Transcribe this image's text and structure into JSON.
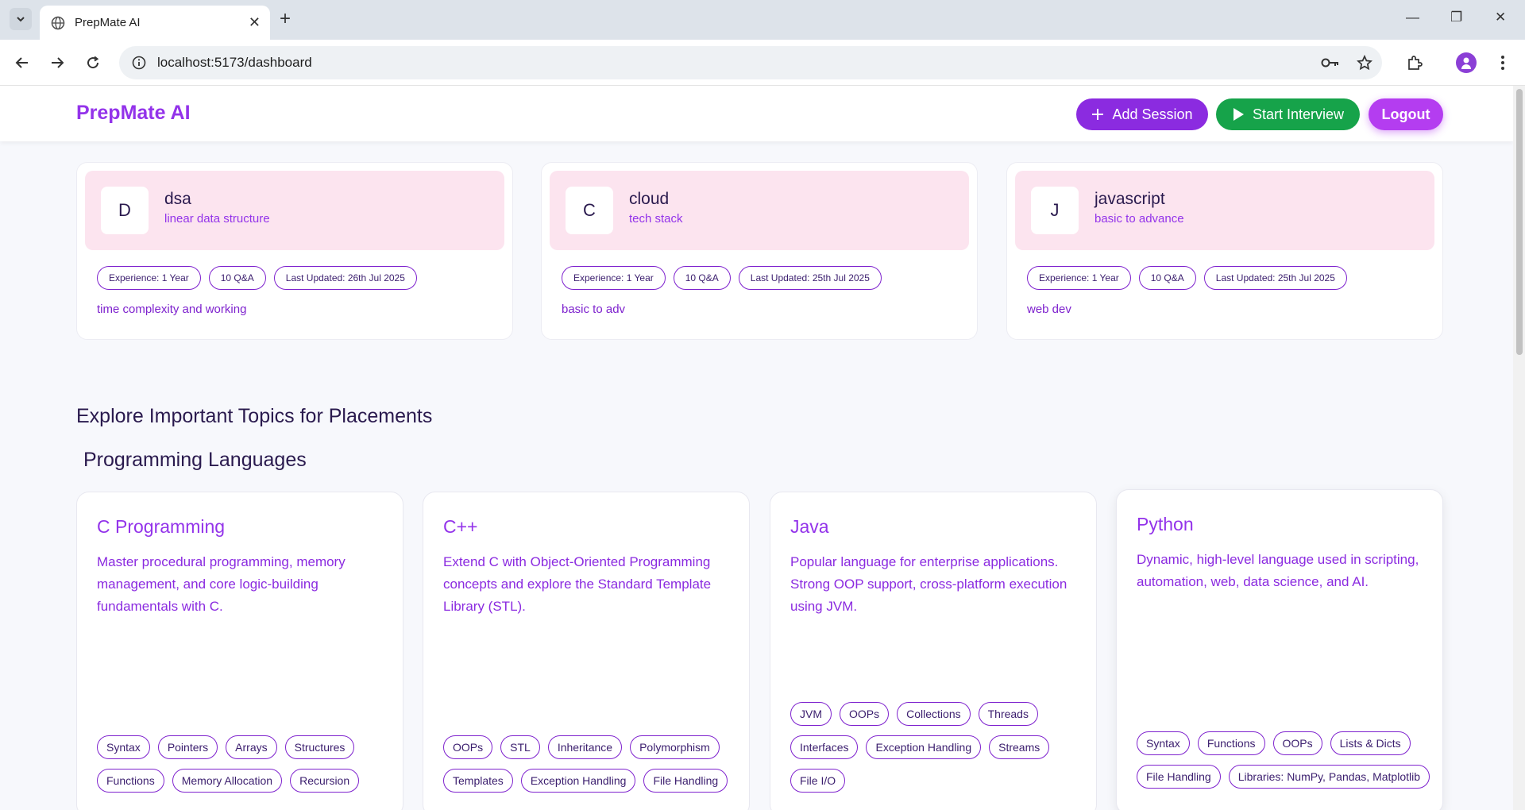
{
  "browser": {
    "tab_title": "PrepMate AI",
    "url": "localhost:5173/dashboard"
  },
  "header": {
    "brand": "PrepMate AI",
    "add_session": "Add Session",
    "start_interview": "Start Interview",
    "logout": "Logout"
  },
  "sessions": [
    {
      "letter": "D",
      "title": "dsa",
      "subtitle": "linear data structure",
      "experience": "Experience: 1 Year",
      "qa": "10 Q&A",
      "updated": "Last Updated: 26th Jul 2025",
      "description": "time complexity and working"
    },
    {
      "letter": "C",
      "title": "cloud",
      "subtitle": "tech stack",
      "experience": "Experience: 1 Year",
      "qa": "10 Q&A",
      "updated": "Last Updated: 25th Jul 2025",
      "description": "basic to adv"
    },
    {
      "letter": "J",
      "title": "javascript",
      "subtitle": "basic to advance",
      "experience": "Experience: 1 Year",
      "qa": "10 Q&A",
      "updated": "Last Updated: 25th Jul 2025",
      "description": "web dev"
    }
  ],
  "explore": {
    "title": "Explore Important Topics for Placements",
    "category": "Programming Languages"
  },
  "topics": [
    {
      "title": "C Programming",
      "description": "Master procedural programming, memory management, and core logic-building fundamentals with C.",
      "tags": [
        "Syntax",
        "Pointers",
        "Arrays",
        "Structures",
        "Functions",
        "Memory Allocation",
        "Recursion"
      ]
    },
    {
      "title": "C++",
      "description": "Extend C with Object-Oriented Programming concepts and explore the Standard Template Library (STL).",
      "tags": [
        "OOPs",
        "STL",
        "Inheritance",
        "Polymorphism",
        "Templates",
        "Exception Handling",
        "File Handling"
      ]
    },
    {
      "title": "Java",
      "description": "Popular language for enterprise applications. Strong OOP support, cross-platform execution using JVM.",
      "tags": [
        "JVM",
        "OOPs",
        "Collections",
        "Threads",
        "Interfaces",
        "Exception Handling",
        "Streams",
        "File I/O"
      ]
    },
    {
      "title": "Python",
      "description": "Dynamic, high-level language used in scripting, automation, web, data science, and AI.",
      "tags": [
        "Syntax",
        "Functions",
        "OOPs",
        "Lists & Dicts",
        "File Handling",
        "Libraries: NumPy, Pandas, Matplotlib"
      ]
    }
  ],
  "colors": {
    "brand": "#9333ea",
    "add_button": "#8b2be0",
    "start_button": "#16a34a",
    "logout_button": "#b43df0",
    "session_header": "#fce4ef"
  },
  "icons": {
    "add": "plus-icon",
    "start": "play-icon"
  }
}
